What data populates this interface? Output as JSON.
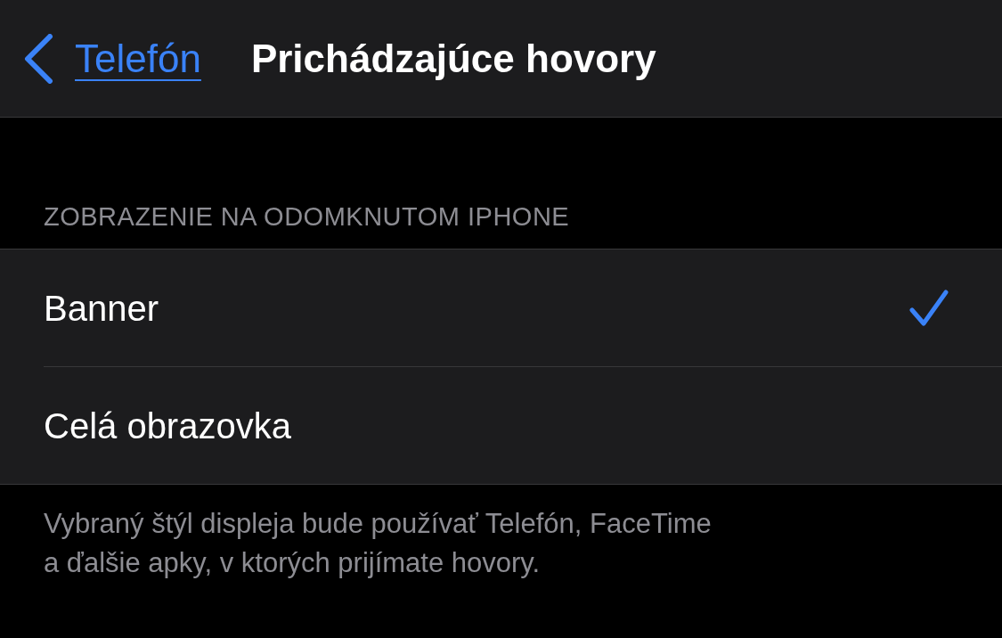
{
  "nav": {
    "back_label": "Telefón",
    "title": "Prichádzajúce hovory"
  },
  "section": {
    "header": "ZOBRAZENIE NA ODOMKNUTOM IPHONE",
    "options": [
      {
        "label": "Banner",
        "selected": true
      },
      {
        "label": "Celá obrazovka",
        "selected": false
      }
    ],
    "footer_lines": [
      "Vybraný štýl displeja bude používať Telefón, FaceTime",
      "a ďalšie apky, v ktorých prijímate hovory."
    ]
  }
}
